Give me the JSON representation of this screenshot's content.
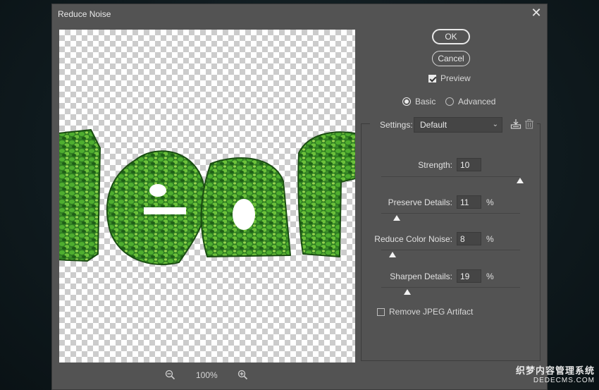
{
  "dialog": {
    "title": "Reduce Noise",
    "ok_label": "OK",
    "cancel_label": "Cancel",
    "preview_label": "Preview",
    "preview_checked": true,
    "mode_basic_label": "Basic",
    "mode_advanced_label": "Advanced",
    "selected_mode": "Basic",
    "settings_label": "Settings:",
    "settings_value": "Default",
    "zoom_level": "100%",
    "remove_jpeg_label": "Remove JPEG Artifact",
    "remove_jpeg_checked": false
  },
  "params": [
    {
      "label": "Strength:",
      "value": "10",
      "unit": "",
      "level": 1.0
    },
    {
      "label": "Preserve Details:",
      "value": "11",
      "unit": "%",
      "level": 0.11
    },
    {
      "label": "Reduce Color Noise:",
      "value": "8",
      "unit": "%",
      "level": 0.08
    },
    {
      "label": "Sharpen Details:",
      "value": "19",
      "unit": "%",
      "level": 0.19
    }
  ],
  "watermark": {
    "line1": "织梦内容管理系统",
    "line2": "DEDECMS.COM"
  },
  "icons": [
    "close-icon",
    "zoom-out-icon",
    "zoom-in-icon",
    "save-preset-icon",
    "trash-icon",
    "chevron-down-icon"
  ],
  "colors": {
    "dialog_bg": "#535353",
    "leaf_green": "#3f9a2c",
    "leaf_dark": "#1f5e17",
    "leaf_light": "#8fd04a"
  }
}
